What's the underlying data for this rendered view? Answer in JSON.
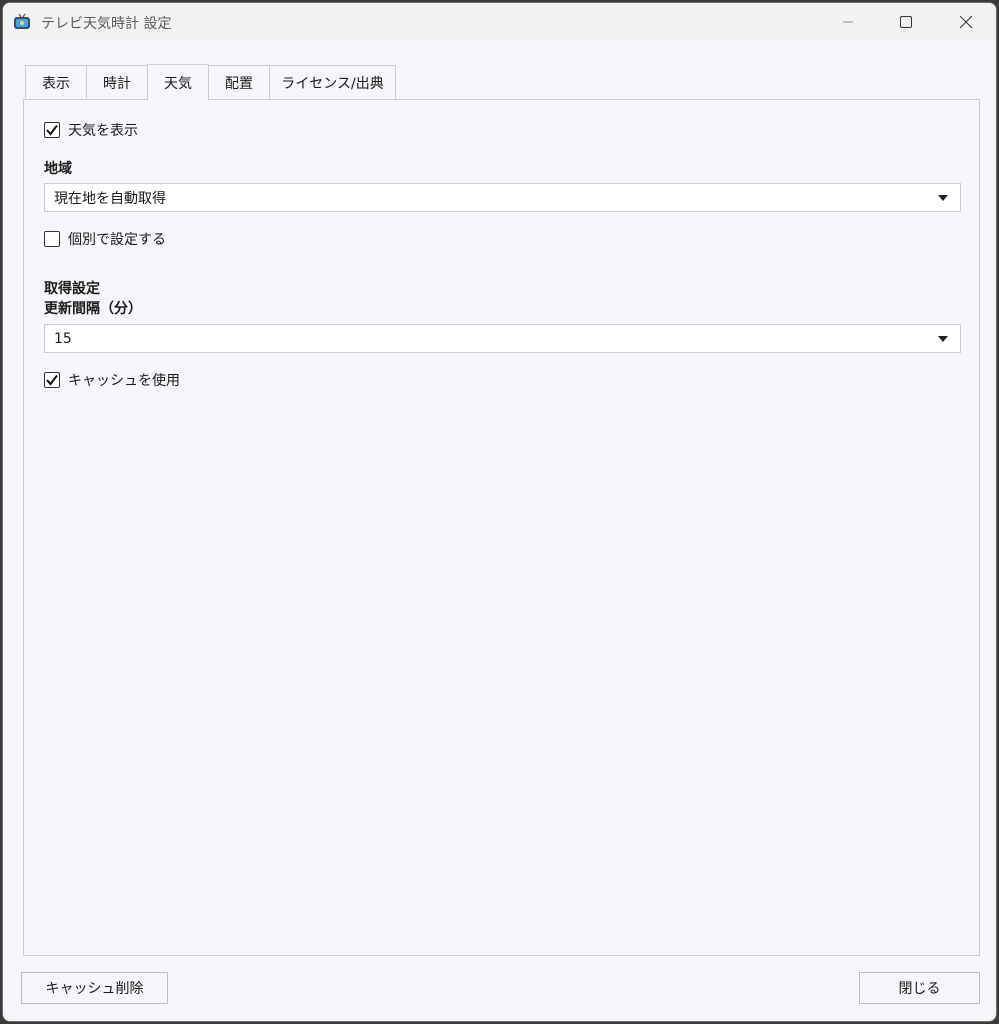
{
  "window": {
    "title": "テレビ天気時計 設定"
  },
  "tabs": [
    {
      "label": "表示"
    },
    {
      "label": "時計"
    },
    {
      "label": "天気"
    },
    {
      "label": "配置"
    },
    {
      "label": "ライセンス/出典"
    }
  ],
  "weather_tab": {
    "show_weather": {
      "label": "天気を表示",
      "checked": true
    },
    "region": {
      "label": "地域",
      "selected": "現在地を自動取得"
    },
    "individual": {
      "label": "個別で設定する",
      "checked": false
    },
    "fetch_settings": {
      "label": "取得設定",
      "interval_label": "更新間隔（分）",
      "interval_selected": "15"
    },
    "use_cache": {
      "label": "キャッシュを使用",
      "checked": true
    }
  },
  "footer": {
    "clear_cache_label": "キャッシュ削除",
    "close_label": "閉じる"
  },
  "icons": {
    "app": "tv-icon",
    "minimize": "minimize-icon",
    "maximize": "maximize-icon",
    "close": "close-icon",
    "checkmark": "checkmark-icon",
    "dropdown": "chevron-down-icon"
  },
  "colors": {
    "background": "#f4f6f9",
    "border": "#c9ccd1",
    "text": "#1a1a1a"
  }
}
